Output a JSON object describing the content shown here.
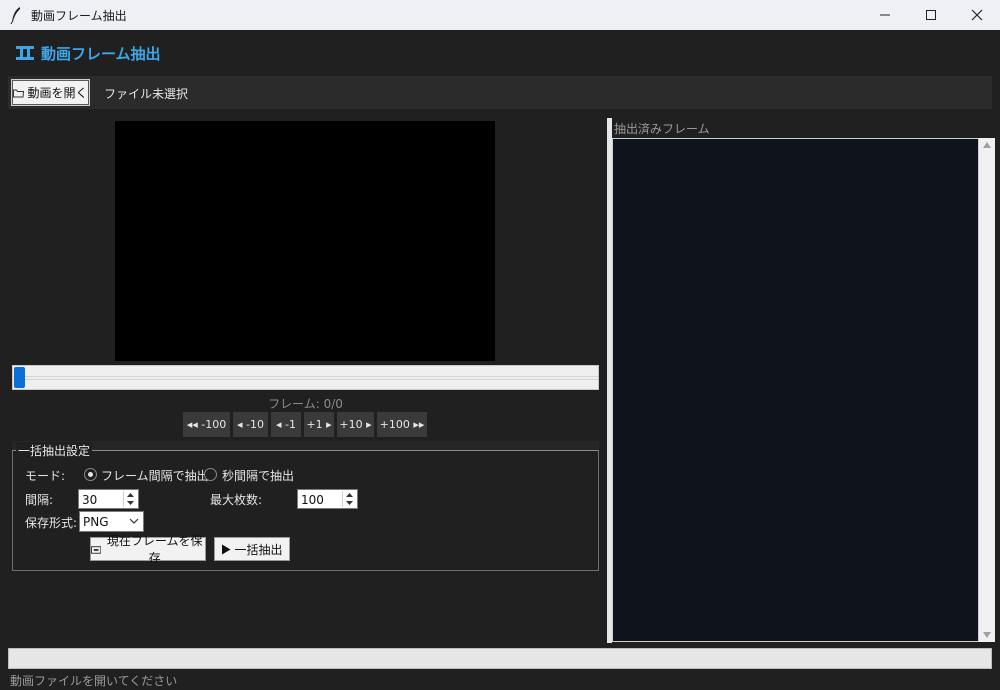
{
  "window": {
    "title": "動画フレーム抽出"
  },
  "header": {
    "title": "動画フレーム抽出"
  },
  "toolbar": {
    "open_label": "動画を開く",
    "file_status": "ファイル未選択"
  },
  "player": {
    "frame_label": "フレーム: 0/0",
    "position": 0,
    "steps": [
      "◂◂ -100",
      "◂ -10",
      "◂ -1",
      "+1 ▸",
      "+10 ▸",
      "+100 ▸▸"
    ]
  },
  "batch": {
    "title": "一括抽出設定",
    "mode_label": "モード:",
    "mode_frames": "フレーム間隔で抽出",
    "mode_seconds": "秒間隔で抽出",
    "interval_label": "間隔:",
    "interval_value": "30",
    "max_label": "最大枚数:",
    "max_value": "100",
    "format_label": "保存形式:",
    "format_value": "PNG",
    "save_current": "現在フレームを保存",
    "extract_all": "一括抽出"
  },
  "extracted": {
    "label": "抽出済みフレーム"
  },
  "progress": 0,
  "status": "動画ファイルを開いてください",
  "colors": {
    "accent": "#3ea6e8",
    "slider": "#0d6fd6",
    "canvas": "#0f131b"
  }
}
